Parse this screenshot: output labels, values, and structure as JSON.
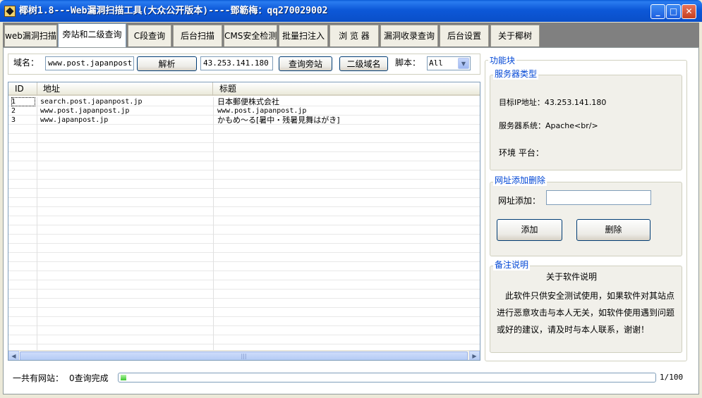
{
  "window": {
    "title": "椰树1.8---Web漏洞扫描工具(大众公开版本)----鄧簕梅：qq270029002",
    "controls": {
      "minimize": "_",
      "maximize": "□",
      "close": "✕"
    }
  },
  "tabs": [
    {
      "label": "web漏洞扫描"
    },
    {
      "label": "旁站和二级查询",
      "active": true
    },
    {
      "label": "C段查询"
    },
    {
      "label": "后台扫描"
    },
    {
      "label": "CMS安全检测"
    },
    {
      "label": "批量扫注入"
    },
    {
      "label": "浏 览 器"
    },
    {
      "label": "漏洞收录查询"
    },
    {
      "label": "后台设置"
    },
    {
      "label": "关于椰树"
    }
  ],
  "query": {
    "domain_label": "域名：",
    "domain_value": "www.post.japanpost.j",
    "resolve_button": "解析",
    "ip_value": "43.253.141.180",
    "side_site_button": "查询旁站",
    "subdomain_button": "二级域名",
    "script_label": "脚本：",
    "script_value": "All"
  },
  "results": {
    "columns": [
      "ID",
      "地址",
      "标题"
    ],
    "rows": [
      {
        "id": "1",
        "address": "search.post.japanpost.jp",
        "title": "日本郵便株式会社"
      },
      {
        "id": "2",
        "address": "www.post.japanpost.jp",
        "title": "www.post.japanpost.jp"
      },
      {
        "id": "3",
        "address": "www.japanpost.jp",
        "title": "かもめ～る[暑中・残暑見舞はがき]"
      }
    ]
  },
  "panel": {
    "title": "功能块",
    "server": {
      "title": "服务器类型",
      "ip_line": "目标IP地址：43.253.141.180",
      "os_line": "服务器系统：Apache<br/>",
      "env_line": "环境 平台："
    },
    "url_manage": {
      "title": "网址添加删除",
      "add_label": "网址添加：",
      "add_value": "",
      "add_button": "添加",
      "delete_button": "删除"
    },
    "notes": {
      "title": "备注说明",
      "heading": "关于软件说明",
      "lines": [
        "此软件只供安全测试使用，如果软件对其站点",
        "进行恶意攻击与本人无关，如软件使用遇到问题",
        "或好的建议，请及时与本人联系，谢谢！"
      ]
    }
  },
  "status": {
    "total_label": "一共有网站：",
    "query_status": "0查询完成",
    "progress_fraction": 0.01,
    "progress_text": "1/100"
  }
}
